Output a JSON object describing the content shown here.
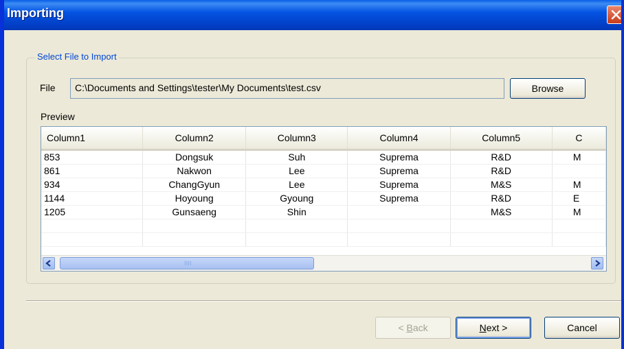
{
  "window": {
    "title": "Importing"
  },
  "group": {
    "label": "Select File to Import"
  },
  "file": {
    "label": "File",
    "path": "C:\\Documents and Settings\\tester\\My Documents\\test.csv",
    "browse": "Browse"
  },
  "preview": {
    "label": "Preview",
    "columns": [
      "Column1",
      "Column2",
      "Column3",
      "Column4",
      "Column5",
      "C"
    ],
    "rows": [
      [
        "853",
        "Dongsuk",
        "Suh",
        "Suprema",
        "R&D",
        "M"
      ],
      [
        "861",
        "Nakwon",
        "Lee",
        "Suprema",
        "R&D",
        ""
      ],
      [
        "934",
        "ChangGyun",
        "Lee",
        "Suprema",
        "M&S",
        "M"
      ],
      [
        "1144",
        "Hoyoung",
        "Gyoung",
        "Suprema",
        "R&D",
        "E"
      ],
      [
        "1205",
        "Gunsaeng",
        "Shin",
        "",
        "M&S",
        "M"
      ],
      [
        "",
        "",
        "",
        "",
        "",
        ""
      ],
      [
        "",
        "",
        "",
        "",
        "",
        ""
      ]
    ]
  },
  "scrollbar": {
    "grip": "IIII"
  },
  "buttons": {
    "back": {
      "prefix": "< ",
      "accel": "B",
      "rest": "ack"
    },
    "next": {
      "accel": "N",
      "rest": "ext >"
    },
    "cancel": "Cancel"
  },
  "colors": {
    "title_bar": "#0454e3",
    "group_label": "#0046d5",
    "dialog_bg": "#ece9d8"
  }
}
